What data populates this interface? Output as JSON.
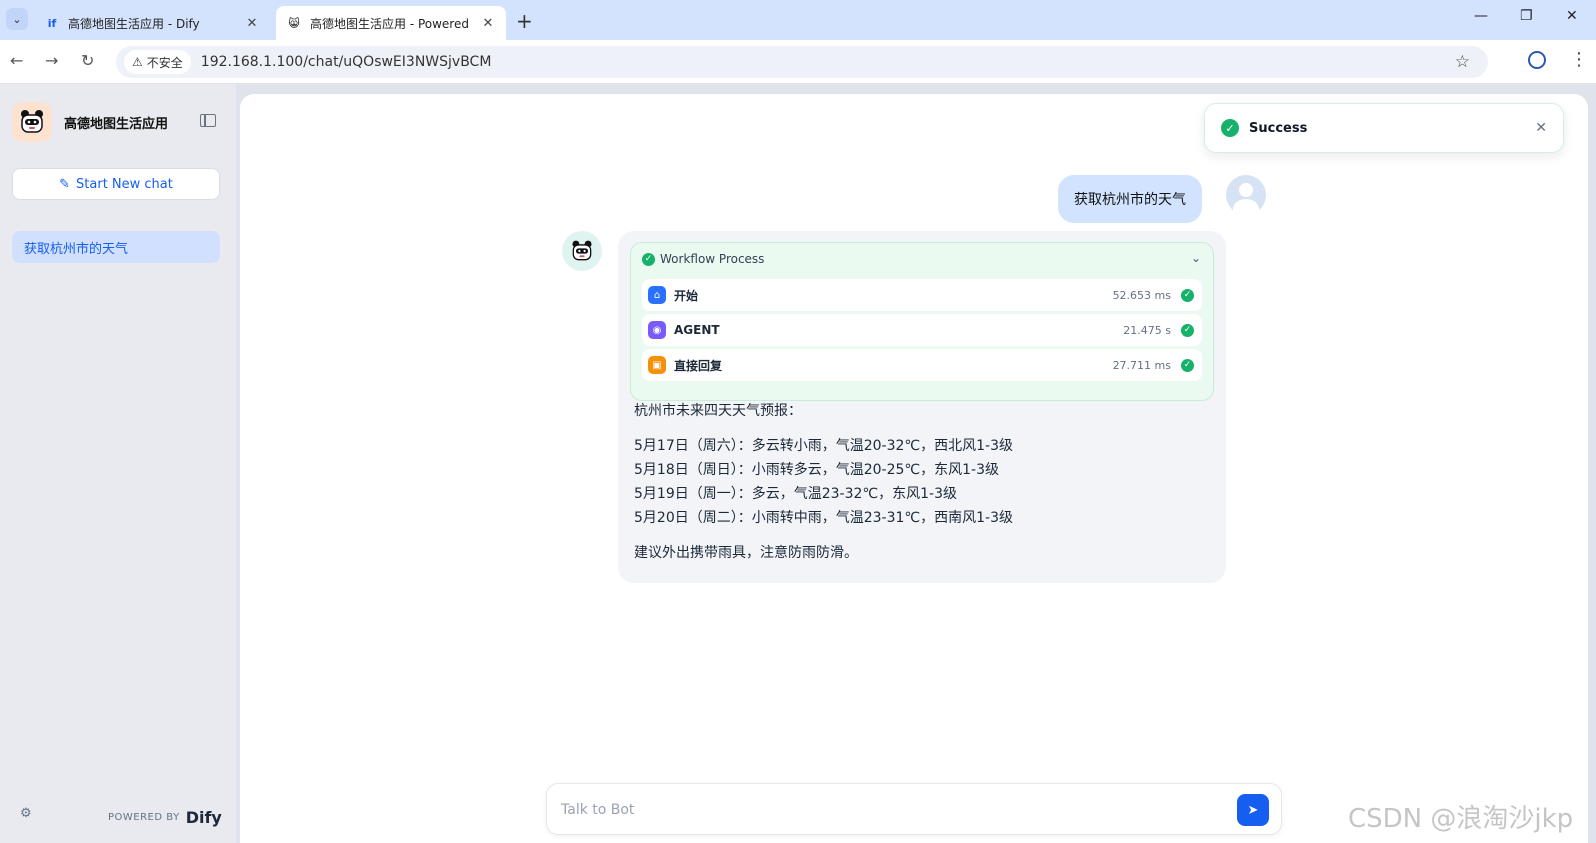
{
  "browser": {
    "tabs": [
      {
        "title": "高德地图生活应用 - Dify",
        "favicon": "if"
      },
      {
        "title": "高德地图生活应用 - Powered",
        "favicon": "😸"
      }
    ],
    "new_tab_label": "+",
    "security_label": "不安全",
    "url": "192.168.1.100/chat/uQOswEI3NWSjvBCM",
    "icons": [
      "chevron-down-icon",
      "close-icon",
      "plus-icon",
      "minimize-icon",
      "restore-icon",
      "back-icon",
      "forward-icon",
      "reload-icon",
      "warning-icon",
      "star-icon",
      "profile-icon",
      "kebab-icon"
    ]
  },
  "sidebar": {
    "app_name": "高德地图生活应用",
    "new_chat_label": "Start New chat",
    "conversations": [
      {
        "label": "获取杭州市的天气"
      }
    ],
    "powered_by": "POWERED BY",
    "brand": "Dify"
  },
  "toast": {
    "text": "Success",
    "status_color": "#17b26a"
  },
  "chat": {
    "user_message": "获取杭州市的天气",
    "workflow": {
      "title": "Workflow Process",
      "nodes": [
        {
          "name": "开始",
          "time": "52.653 ms",
          "color": "#2970ff",
          "icon": "home-icon"
        },
        {
          "name": "AGENT",
          "time": "21.475 s",
          "color": "#7a5af8",
          "icon": "agent-icon"
        },
        {
          "name": "直接回复",
          "time": "27.711 ms",
          "color": "#f79009",
          "icon": "reply-icon"
        }
      ]
    },
    "answer": {
      "intro": "杭州市未来四天天气预报：",
      "lines": [
        "5月17日（周六）：多云转小雨，气温20-32℃，西北风1-3级",
        "5月18日（周日）：小雨转多云，气温20-25℃，东风1-3级",
        "5月19日（周一）：多云，气温23-32℃，东风1-3级",
        "5月20日（周二）：小雨转中雨，气温23-31℃，西南风1-3级"
      ],
      "advice": "建议外出携带雨具，注意防雨防滑。"
    },
    "input_placeholder": "Talk to Bot"
  },
  "watermark": "CSDN @浪淘沙jkp",
  "colors": {
    "accent": "#155eef",
    "sidebar_bg": "#e8eaf0",
    "user_bubble": "#d1e3ff",
    "success": "#17b26a"
  }
}
